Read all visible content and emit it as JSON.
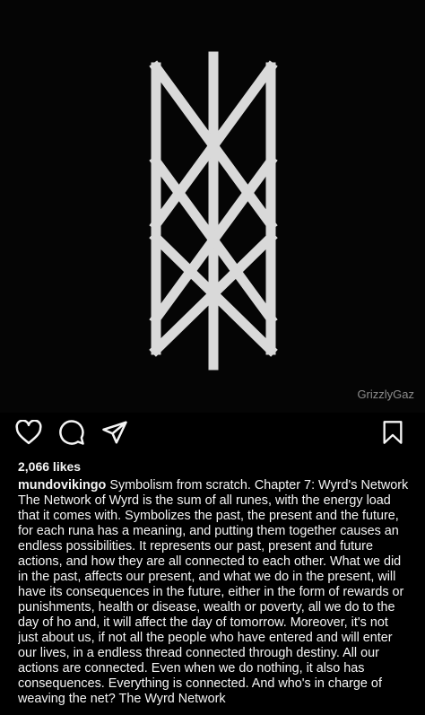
{
  "post": {
    "watermark": "GrizzlyGaz",
    "image_icon": "web-of-wyrd-rune-icon"
  },
  "actions": {
    "like_icon": "heart-icon",
    "comment_icon": "comment-icon",
    "share_icon": "send-icon",
    "save_icon": "bookmark-icon"
  },
  "likes": "2,066 likes",
  "caption": {
    "username": "mundovikingo",
    "text": "Symbolism from scratch. Chapter 7: Wyrd's Network The Network of Wyrd is the sum of all runes, with the energy load that it comes with. Symbolizes the past, the present and the future, for each runa has a meaning, and putting them together causes an endless possibilities. It represents our past, present and future actions, and how they are all connected to each other. What we did in the past, affects our present, and what we do in the present, will have its consequences in the future, either in the form of rewards or punishments, health or disease, wealth or poverty, all we do to the day of ho and, it will affect the day of tomorrow. Moreover, it's not just about us, if not all the people who have entered and will enter our lives, in a endless thread connected through destiny. All our actions are connected. Even when we do nothing, it also has consequences. Everything is connected. And who's in charge of weaving the net? The Wyrd Network"
  }
}
